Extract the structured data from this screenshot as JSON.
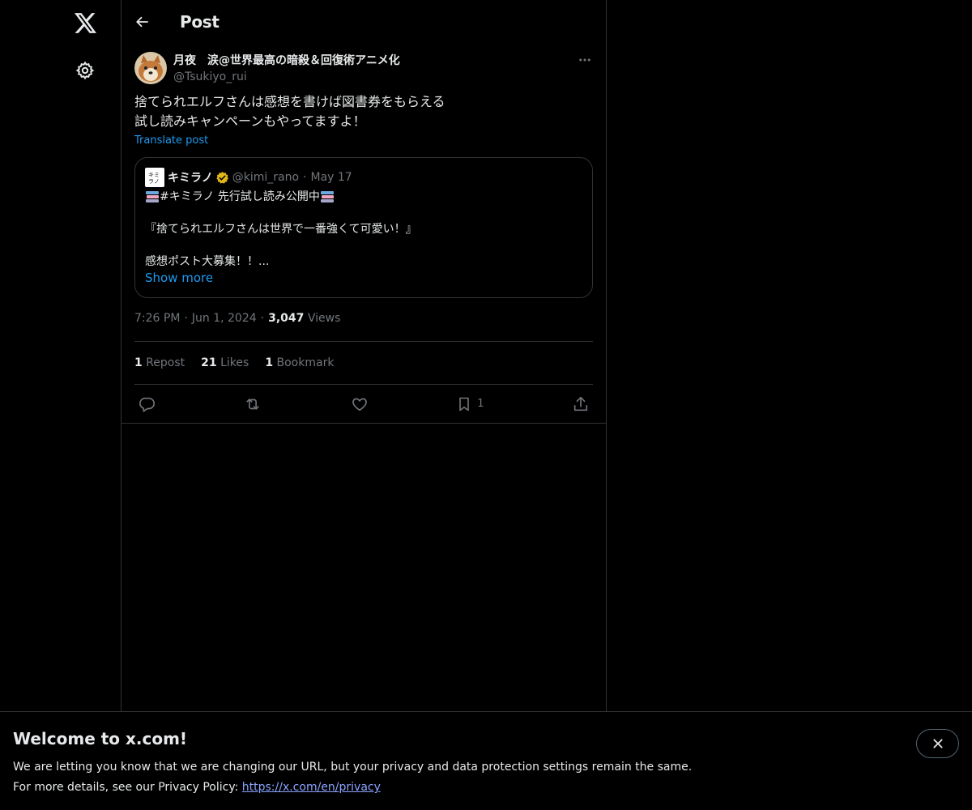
{
  "nav": {
    "logo_icon": "x-logo-icon",
    "settings_icon": "gear-icon"
  },
  "header": {
    "title": "Post",
    "back_icon": "arrow-left-icon"
  },
  "post": {
    "author_name": "月夜　涙@世界最高の暗殺＆回復術アニメ化",
    "author_handle": "@Tsukiyo_rui",
    "text_lines": [
      "捨てられエルフさんは感想を書けば図書券をもらえる",
      "試し読みキャンペーンもやってますよ！"
    ],
    "translate_label": "Translate post",
    "time": "7:26 PM",
    "date": "Jun 1, 2024",
    "views_count": "3,047",
    "views_label": "Views",
    "reposts_count": "1",
    "reposts_label": "Repost",
    "likes_count": "21",
    "likes_label": "Likes",
    "bookmarks_count": "1",
    "bookmarks_label": "Bookmark",
    "bookmark_action_count": "1"
  },
  "quote": {
    "avatar_text": "キミラノ",
    "name": "キミラノ",
    "handle": "@kimi_rano",
    "date": "May 17",
    "line1": "#キミラノ 先行試し読み公開中",
    "line2": "『捨てられエルフさんは世界で一番強くて可愛い！』",
    "line3": "感想ポスト大募集！！...",
    "show_more": "Show more"
  },
  "banner": {
    "title": "Welcome to x.com!",
    "line1": "We are letting you know that we are changing our URL, but your privacy and data protection settings remain the same.",
    "line2_prefix": "For more details, see our Privacy Policy: ",
    "link": "https://x.com/en/privacy"
  },
  "colors": {
    "accent": "#1d9bf0",
    "muted": "#71767b",
    "text": "#e7e9ea",
    "border": "#2f3336",
    "verified": "#e2b719"
  }
}
